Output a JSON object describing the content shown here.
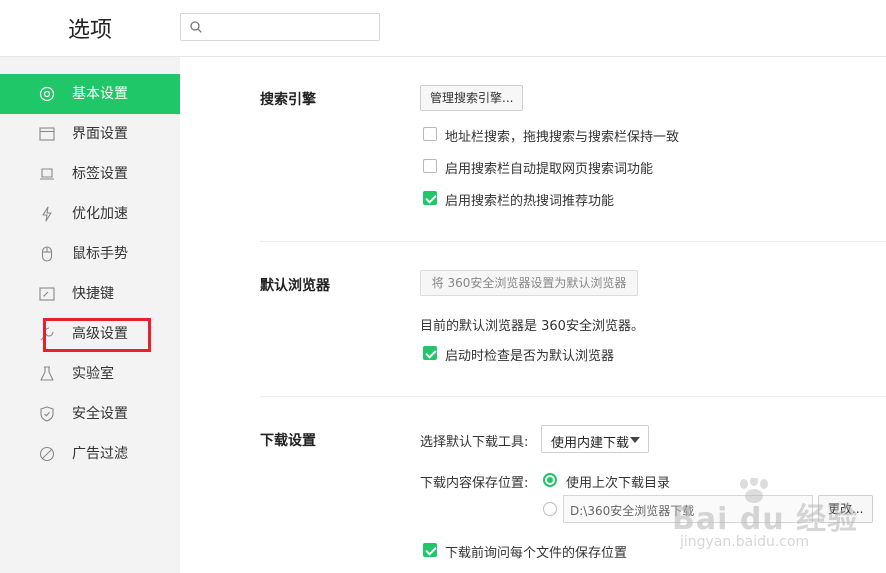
{
  "header": {
    "title": "选项",
    "search_placeholder": ""
  },
  "sidebar": {
    "items": [
      {
        "label": "基本设置",
        "icon": "target-icon",
        "active": true
      },
      {
        "label": "界面设置",
        "icon": "window-icon",
        "active": false
      },
      {
        "label": "标签设置",
        "icon": "tab-icon",
        "active": false
      },
      {
        "label": "优化加速",
        "icon": "lightning-icon",
        "active": false
      },
      {
        "label": "鼠标手势",
        "icon": "mouse-icon",
        "active": false
      },
      {
        "label": "快捷键",
        "icon": "shortcut-icon",
        "active": false
      },
      {
        "label": "高级设置",
        "icon": "wrench-icon",
        "active": false
      },
      {
        "label": "实验室",
        "icon": "flask-icon",
        "active": false
      },
      {
        "label": "安全设置",
        "icon": "shield-icon",
        "active": false
      },
      {
        "label": "广告过滤",
        "icon": "block-icon",
        "active": false
      }
    ]
  },
  "search_engine": {
    "title": "搜索引擎",
    "manage_button": "管理搜索引擎...",
    "options": [
      {
        "label": "地址栏搜索，拖拽搜索与搜索栏保持一致",
        "checked": false
      },
      {
        "label": "启用搜索栏自动提取网页搜索词功能",
        "checked": false
      },
      {
        "label": "启用搜索栏的热搜词推荐功能",
        "checked": true
      }
    ]
  },
  "default_browser": {
    "title": "默认浏览器",
    "set_button": "将 360安全浏览器设置为默认浏览器",
    "status_text": "目前的默认浏览器是 360安全浏览器。",
    "options": [
      {
        "label": "启动时检查是否为默认浏览器",
        "checked": true
      }
    ]
  },
  "download": {
    "title": "下载设置",
    "tool_label": "选择默认下载工具:",
    "tool_value": "使用内建下载",
    "location_label": "下载内容保存位置:",
    "radio_last": "使用上次下载目录",
    "radio_last_selected": true,
    "path_value": "D:\\360安全浏览器下载",
    "change_button": "更改...",
    "ask_option": {
      "label": "下载前询问每个文件的保存位置",
      "checked": true
    }
  },
  "watermark": {
    "brand": "Bai du 经验",
    "url": "jingyan.baidu.com"
  },
  "colors": {
    "accent": "#20c769",
    "highlight_box": "#e8202a"
  }
}
